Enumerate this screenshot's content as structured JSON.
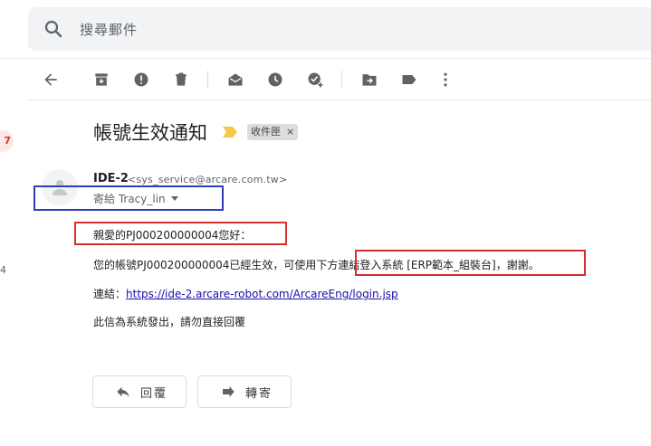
{
  "search": {
    "placeholder": "搜尋郵件"
  },
  "sidebar": {
    "badge": "7",
    "number": "4"
  },
  "toolbar": {
    "icons": [
      "back-arrow-icon",
      "archive-icon",
      "report-spam-icon",
      "delete-icon",
      "mark-unread-icon",
      "snooze-icon",
      "add-task-icon",
      "move-to-icon",
      "label-icon",
      "more-vertical-icon"
    ]
  },
  "email": {
    "subject": "帳號生效通知",
    "label": "收件匣",
    "label_close": "×",
    "sender_name": "IDE-2",
    "sender_email": "<sys_service@arcare.com.tw>",
    "to": "寄給 Tracy_lin",
    "greeting": "親愛的PJ000200000004您好：",
    "line2": "您的帳號PJ000200000004已經生效，可使用下方連結登入系統 [ERP範本_組裝台]，謝謝。",
    "link_prefix": "連結：",
    "link": "https://ide-2.arcare-robot.com/ArcareEng/login.jsp",
    "footer": "此信為系統發出，請勿直接回覆"
  },
  "actions": {
    "reply": "回覆",
    "forward": "轉寄"
  },
  "colors": {
    "annotation_blue": "#2b3fb8",
    "annotation_red": "#d32f2f",
    "important": "#f2c94c"
  }
}
